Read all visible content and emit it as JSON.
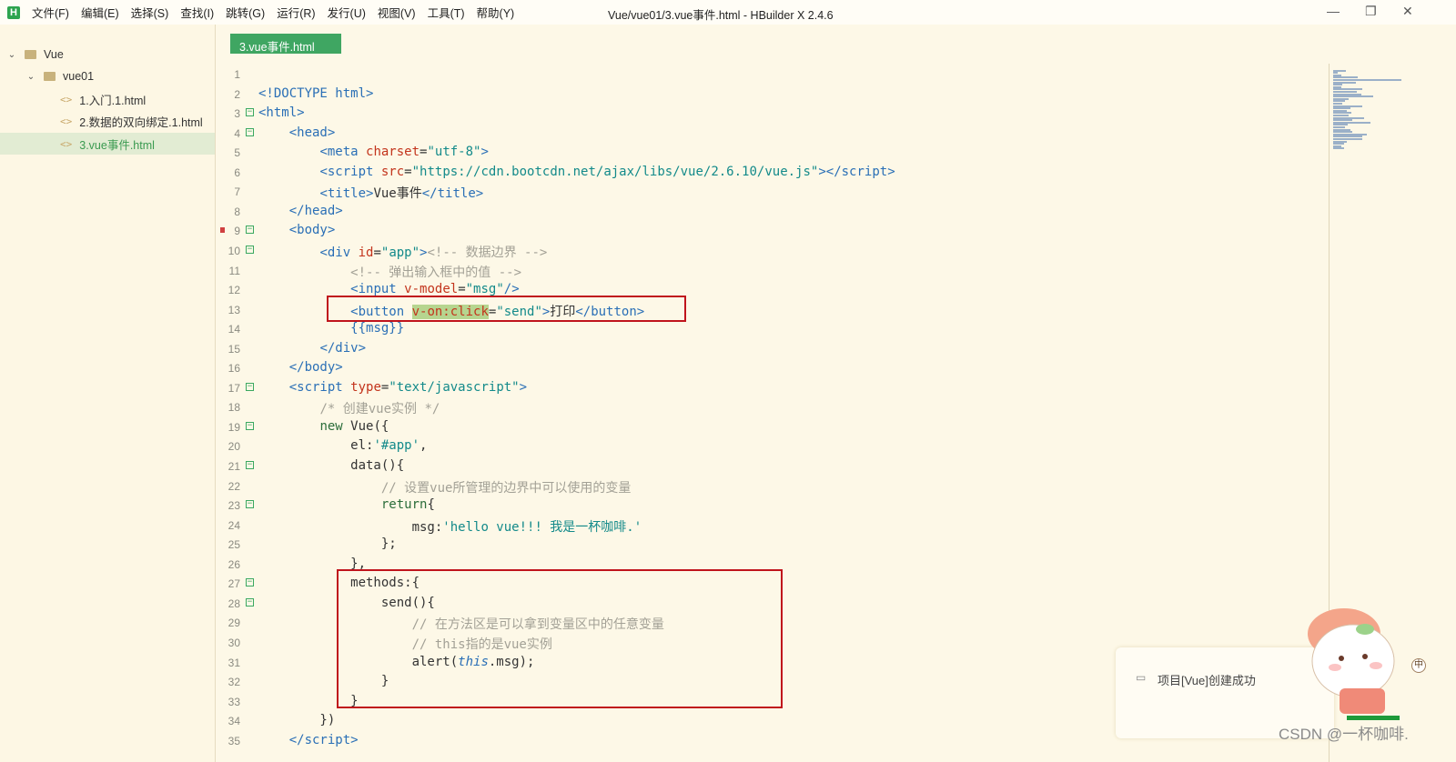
{
  "titlebar": {
    "logo": "H",
    "menus": [
      "文件(F)",
      "编辑(E)",
      "选择(S)",
      "查找(I)",
      "跳转(G)",
      "运行(R)",
      "发行(U)",
      "视图(V)",
      "工具(T)",
      "帮助(Y)"
    ],
    "title": "Vue/vue01/3.vue事件.html - HBuilder X 2.4.6",
    "minimize": "—",
    "restore": "❐",
    "close": "✕"
  },
  "sidebar": {
    "project": "Vue",
    "folder": "vue01",
    "files": [
      "1.入门.1.html",
      "2.数据的双向绑定.1.html",
      "3.vue事件.html"
    ],
    "selected_index": 2
  },
  "tab": {
    "label": "3.vue事件.html"
  },
  "code": {
    "lines": [
      [],
      [
        [
          "tag",
          "<!DOCTYPE html>"
        ]
      ],
      [
        [
          "tag",
          "<html>"
        ]
      ],
      [
        [
          "txt",
          "    "
        ],
        [
          "tag",
          "<head>"
        ]
      ],
      [
        [
          "txt",
          "        "
        ],
        [
          "tag",
          "<meta "
        ],
        [
          "attr",
          "charset"
        ],
        [
          "txt",
          "="
        ],
        [
          "str",
          "\"utf-8\""
        ],
        [
          "tag",
          ">"
        ]
      ],
      [
        [
          "txt",
          "        "
        ],
        [
          "tag",
          "<script "
        ],
        [
          "attr",
          "src"
        ],
        [
          "txt",
          "="
        ],
        [
          "str",
          "\"https://cdn.bootcdn.net/ajax/libs/vue/2.6.10/vue.js\""
        ],
        [
          "tag",
          "></script>"
        ]
      ],
      [
        [
          "txt",
          "        "
        ],
        [
          "tag",
          "<title>"
        ],
        [
          "txt",
          "Vue事件"
        ],
        [
          "tag",
          "</title>"
        ]
      ],
      [
        [
          "txt",
          "    "
        ],
        [
          "tag",
          "</head>"
        ]
      ],
      [
        [
          "txt",
          "    "
        ],
        [
          "tag",
          "<body>"
        ]
      ],
      [
        [
          "txt",
          "        "
        ],
        [
          "tag",
          "<div "
        ],
        [
          "attr",
          "id"
        ],
        [
          "txt",
          "="
        ],
        [
          "str",
          "\"app\""
        ],
        [
          "tag",
          ">"
        ],
        [
          "cm",
          "<!-- 数据边界 -->"
        ]
      ],
      [
        [
          "txt",
          "            "
        ],
        [
          "cm",
          "<!-- 弹出输入框中的值 -->"
        ]
      ],
      [
        [
          "txt",
          "            "
        ],
        [
          "tag",
          "<input "
        ],
        [
          "attr",
          "v-model"
        ],
        [
          "txt",
          "="
        ],
        [
          "str",
          "\"msg\""
        ],
        [
          "tag",
          "/>"
        ]
      ],
      [
        [
          "txt",
          "            "
        ],
        [
          "tag",
          "<button "
        ],
        [
          "hl",
          "v-on:click"
        ],
        [
          "txt",
          "="
        ],
        [
          "str",
          "\"send\""
        ],
        [
          "tag",
          ">"
        ],
        [
          "txt",
          "打印"
        ],
        [
          "tag",
          "</button>"
        ]
      ],
      [
        [
          "txt",
          "            "
        ],
        [
          "tag",
          "{{msg}}"
        ]
      ],
      [
        [
          "txt",
          "        "
        ],
        [
          "tag",
          "</div>"
        ]
      ],
      [
        [
          "txt",
          "    "
        ],
        [
          "tag",
          "</body>"
        ]
      ],
      [
        [
          "txt",
          "    "
        ],
        [
          "tag",
          "<script "
        ],
        [
          "attr",
          "type"
        ],
        [
          "txt",
          "="
        ],
        [
          "str",
          "\"text/javascript\""
        ],
        [
          "tag",
          ">"
        ]
      ],
      [
        [
          "txt",
          "        "
        ],
        [
          "cm",
          "/* 创建vue实例 */"
        ]
      ],
      [
        [
          "txt",
          "        "
        ],
        [
          "kw",
          "new "
        ],
        [
          "txt",
          "Vue({"
        ]
      ],
      [
        [
          "txt",
          "            el:"
        ],
        [
          "str",
          "'#app'"
        ],
        [
          "txt",
          ","
        ]
      ],
      [
        [
          "txt",
          "            data(){"
        ]
      ],
      [
        [
          "txt",
          "                "
        ],
        [
          "cm",
          "// 设置vue所管理的边界中可以使用的变量"
        ]
      ],
      [
        [
          "txt",
          "                "
        ],
        [
          "kw",
          "return"
        ],
        [
          "txt",
          "{"
        ]
      ],
      [
        [
          "txt",
          "                    msg:"
        ],
        [
          "str",
          "'hello vue!!! 我是一杯咖啡.'"
        ]
      ],
      [
        [
          "txt",
          "                };"
        ]
      ],
      [
        [
          "txt",
          "            },"
        ]
      ],
      [
        [
          "txt",
          "            methods:{"
        ]
      ],
      [
        [
          "txt",
          "                send(){"
        ]
      ],
      [
        [
          "txt",
          "                    "
        ],
        [
          "cm",
          "// 在方法区是可以拿到变量区中的任意变量"
        ]
      ],
      [
        [
          "txt",
          "                    "
        ],
        [
          "cm",
          "// this指的是vue实例"
        ]
      ],
      [
        [
          "txt",
          "                    alert("
        ],
        [
          "it",
          "this"
        ],
        [
          "txt",
          ".msg);"
        ]
      ],
      [
        [
          "txt",
          "                }"
        ]
      ],
      [
        [
          "txt",
          "            }"
        ]
      ],
      [
        [
          "txt",
          "        })"
        ]
      ],
      [
        [
          "txt",
          "    "
        ],
        [
          "tag",
          "</script>"
        ]
      ]
    ],
    "fold_lines": [
      3,
      4,
      9,
      10,
      17,
      19,
      21,
      23,
      27,
      28
    ]
  },
  "toast": {
    "text": "项目[Vue]创建成功"
  },
  "ime": {
    "label": "中"
  },
  "watermark": "CSDN @一杯咖啡."
}
